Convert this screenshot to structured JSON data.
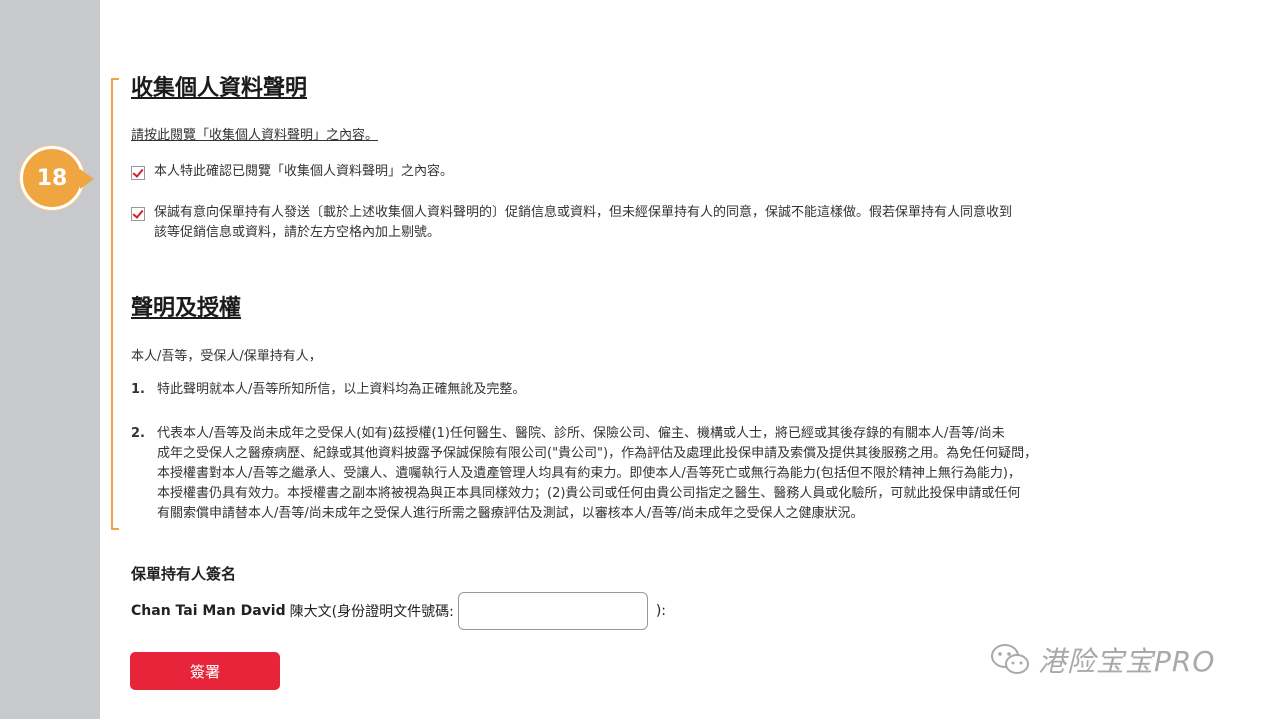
{
  "marker": {
    "step": "18"
  },
  "section1": {
    "title": "收集個人資料聲明",
    "link_text": "請按此閱覽「收集個人資料聲明」之內容。",
    "checkbox1": "本人特此確認已閱覽「收集個人資料聲明」之內容。",
    "checkbox2_line1": "保誠有意向保單持有人發送〔載於上述收集個人資料聲明的〕促銷信息或資料，但未經保單持有人的同意，保誠不能這樣做。假若保單持有人同意收到",
    "checkbox2_line2": "該等促銷信息或資料，請於左方空格內加上剔號。"
  },
  "section2": {
    "title": "聲明及授權",
    "intro": "本人/吾等，受保人/保單持有人，",
    "items": [
      {
        "num": "1.",
        "lines": [
          "特此聲明就本人/吾等所知所信，以上資料均為正確無訛及完整。"
        ]
      },
      {
        "num": "2.",
        "lines": [
          "代表本人/吾等及尚未成年之受保人(如有)茲授權(1)任何醫生、醫院、診所、保險公司、僱主、機構或人士，將已經或其後存錄的有關本人/吾等/尚未",
          "成年之受保人之醫療病歷、紀錄或其他資料披露予保誠保險有限公司(\"貴公司\")，作為評估及處理此投保申請及索償及提供其後服務之用。為免任何疑問，",
          "本授權書對本人/吾等之繼承人、受讓人、遺囑執行人及遺產管理人均具有約束力。即使本人/吾等死亡或無行為能力(包括但不限於精神上無行為能力)，",
          "本授權書仍具有效力。本授權書之副本將被視為與正本具同樣效力；(2)貴公司或任何由貴公司指定之醫生、醫務人員或化驗所，可就此投保申請或任何",
          "有關索償申請替本人/吾等/尚未成年之受保人進行所需之醫療評估及測試，以審核本人/吾等/尚未成年之受保人之健康狀況。"
        ]
      }
    ]
  },
  "signature": {
    "title": "保單持有人簽名",
    "name": "Chan Tai Man David",
    "label": "陳大文(身份證明文件號碼:",
    "suffix": "):",
    "id_value": "",
    "button_label": "簽署"
  },
  "watermark": {
    "text": "港险宝宝PRO"
  },
  "colors": {
    "accent": "#f0a640",
    "button": "#e8243a",
    "check": "#d0202e",
    "rail": "#c8c9cc"
  }
}
